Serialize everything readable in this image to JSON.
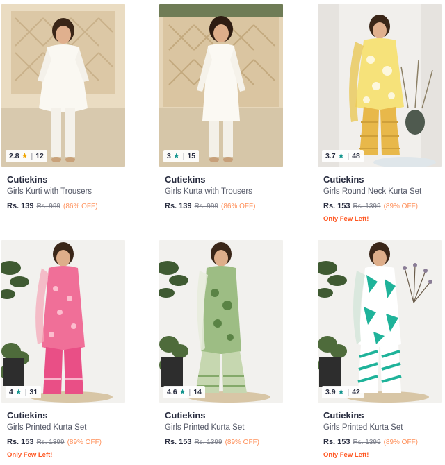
{
  "colors": {
    "star_gold": "#f0a500",
    "star_teal": "#14958f",
    "discount": "#ff905a",
    "few_left": "#ff5722"
  },
  "products": [
    {
      "rating": "2.8",
      "star_icon": "star-icon",
      "star_color": "#f0a500",
      "count": "12",
      "brand": "Cutiekins",
      "title": "Girls Kurti with Trousers",
      "price": "Rs. 139",
      "mrp": "Rs. 999",
      "discount": "(86% OFF)",
      "few_left": ""
    },
    {
      "rating": "3",
      "star_icon": "star-icon",
      "star_color": "#14958f",
      "count": "15",
      "brand": "Cutiekins",
      "title": "Girls Kurta with Trousers",
      "price": "Rs. 139",
      "mrp": "Rs. 999",
      "discount": "(86% OFF)",
      "few_left": ""
    },
    {
      "rating": "3.7",
      "star_icon": "star-icon",
      "star_color": "#14958f",
      "count": "48",
      "brand": "Cutiekins",
      "title": "Girls Round Neck Kurta Set",
      "price": "Rs. 153",
      "mrp": "Rs. 1399",
      "discount": "(89% OFF)",
      "few_left": "Only Few Left!"
    },
    {
      "rating": "4",
      "star_icon": "star-icon",
      "star_color": "#14958f",
      "count": "31",
      "brand": "Cutiekins",
      "title": "Girls Printed Kurta Set",
      "price": "Rs. 153",
      "mrp": "Rs. 1399",
      "discount": "(89% OFF)",
      "few_left": "Only Few Left!"
    },
    {
      "rating": "4.6",
      "star_icon": "star-icon",
      "star_color": "#14958f",
      "count": "14",
      "brand": "Cutiekins",
      "title": "Girls Printed Kurta Set",
      "price": "Rs. 153",
      "mrp": "Rs. 1399",
      "discount": "(89% OFF)",
      "few_left": ""
    },
    {
      "rating": "3.9",
      "star_icon": "star-icon",
      "star_color": "#14958f",
      "count": "42",
      "brand": "Cutiekins",
      "title": "Girls Printed Kurta Set",
      "price": "Rs. 153",
      "mrp": "Rs. 1399",
      "discount": "(89% OFF)",
      "few_left": "Only Few Left!"
    }
  ]
}
